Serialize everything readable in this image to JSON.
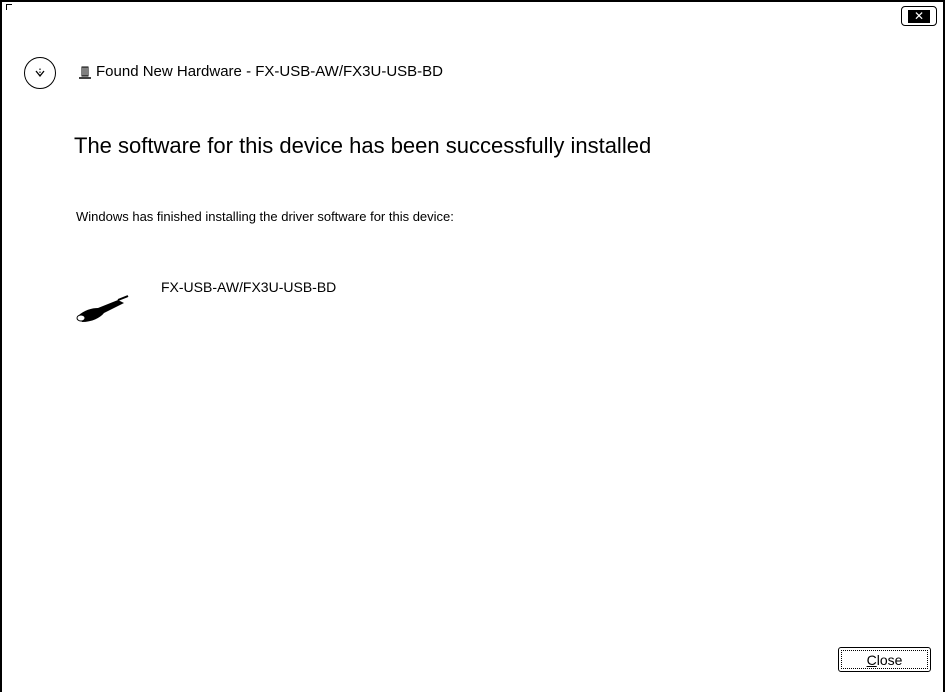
{
  "window": {
    "title": "Found New Hardware - FX-USB-AW/FX3U-USB-BD",
    "close_glyph": "✕"
  },
  "content": {
    "heading": "The software for this device has been successfully installed",
    "subtext": "Windows has finished installing the driver software for this device:",
    "device_name": "FX-USB-AW/FX3U-USB-BD"
  },
  "footer": {
    "close_mnemonic": "C",
    "close_rest": "lose"
  },
  "icons": {
    "back": "back-arrow-icon",
    "hardware": "hardware-device-icon",
    "usb_device": "usb-cable-icon",
    "close": "close-icon"
  }
}
